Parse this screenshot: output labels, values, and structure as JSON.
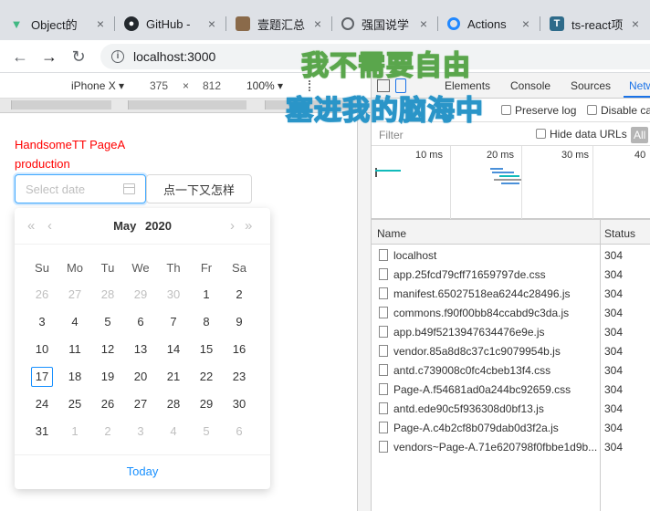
{
  "browser": {
    "tabs": [
      {
        "title": "Object的",
        "icon": "vue-icon"
      },
      {
        "title": "GitHub -",
        "icon": "github-icon"
      },
      {
        "title": "壹题汇总",
        "icon": "avatar-icon"
      },
      {
        "title": "强国说学",
        "icon": "globe-icon"
      },
      {
        "title": "Actions",
        "icon": "actions-icon"
      },
      {
        "title": "ts-react项",
        "icon": "ts-icon"
      }
    ],
    "url": "localhost:3000"
  },
  "device_toolbar": {
    "device": "iPhone X",
    "width": "375",
    "times": "×",
    "height": "812",
    "zoom": "100%"
  },
  "page": {
    "title": "HandsomeTT PageA",
    "env": "production",
    "date_placeholder": "Select date",
    "button_label": "点一下又怎样"
  },
  "calendar": {
    "month": "May",
    "year": "2020",
    "weekdays": [
      "Su",
      "Mo",
      "Tu",
      "We",
      "Th",
      "Fr",
      "Sa"
    ],
    "weeks": [
      [
        "26",
        "27",
        "28",
        "29",
        "30",
        "1",
        "2"
      ],
      [
        "3",
        "4",
        "5",
        "6",
        "7",
        "8",
        "9"
      ],
      [
        "10",
        "11",
        "12",
        "13",
        "14",
        "15",
        "16"
      ],
      [
        "17",
        "18",
        "19",
        "20",
        "21",
        "22",
        "23"
      ],
      [
        "24",
        "25",
        "26",
        "27",
        "28",
        "29",
        "30"
      ],
      [
        "31",
        "1",
        "2",
        "3",
        "4",
        "5",
        "6"
      ]
    ],
    "today_label": "Today"
  },
  "devtools": {
    "tabs": [
      "Elements",
      "Console",
      "Sources",
      "Netw"
    ],
    "preserve_log": "Preserve log",
    "disable_cache": "Disable cac",
    "filter_placeholder": "Filter",
    "hide_data_urls": "Hide data URLs",
    "all_label": "All",
    "timeline_ticks": [
      "10 ms",
      "20 ms",
      "30 ms",
      "40"
    ],
    "columns": {
      "name": "Name",
      "status": "Status"
    },
    "requests": [
      {
        "name": "localhost",
        "status": "304"
      },
      {
        "name": "app.25fcd79cff71659797de.css",
        "status": "304"
      },
      {
        "name": "manifest.65027518ea6244c28496.js",
        "status": "304"
      },
      {
        "name": "commons.f90f00bb84ccabd9c3da.js",
        "status": "304"
      },
      {
        "name": "app.b49f5213947634476e9e.js",
        "status": "304"
      },
      {
        "name": "vendor.85a8d8c37c1c9079954b.js",
        "status": "304"
      },
      {
        "name": "antd.c739008c0fc4cbeb13f4.css",
        "status": "304"
      },
      {
        "name": "Page-A.f54681ad0a244bc92659.css",
        "status": "304"
      },
      {
        "name": "antd.ede90c5f936308d0bf13.js",
        "status": "304"
      },
      {
        "name": "Page-A.c4b2cf8b079dab0d3f2a.js",
        "status": "304"
      },
      {
        "name": "vendors~Page-A.71e620798f0fbbe1d9b...",
        "status": "304"
      }
    ]
  },
  "overlay": {
    "line1": "我不需要自由",
    "line2": "塞进我的脑海中"
  },
  "colors": {
    "accent": "#1890ff",
    "page_text": "#ff0000",
    "overlay1_stroke": "#5aa64c",
    "overlay2_stroke": "#2a95c8"
  }
}
